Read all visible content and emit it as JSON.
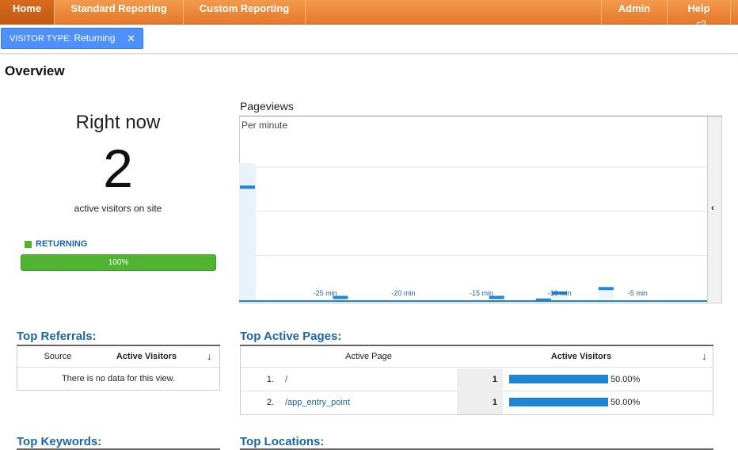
{
  "nav": {
    "home": "Home",
    "standard_reporting": "Standard Reporting",
    "custom_reporting": "Custom Reporting",
    "admin": "Admin",
    "help": "Help"
  },
  "filter": {
    "label": "VISITOR TYPE:",
    "value": "Returning",
    "close": "✕"
  },
  "page_title": "Overview",
  "right_now": {
    "title": "Right now",
    "count": "2",
    "subtitle": "active visitors on site",
    "legend": "RETURNING",
    "bar_label": "100%",
    "bar_fraction": 1.0,
    "legend_color": "#50b432"
  },
  "pageviews": {
    "title": "Pageviews",
    "subtitle": "Per minute",
    "collapse_icon": "‹"
  },
  "chart_data": {
    "type": "bar",
    "title": "Pageviews",
    "subtitle": "Per minute",
    "ylim": [
      0,
      30
    ],
    "y_ticks": [
      "30",
      "20",
      "10"
    ],
    "x_ticks": [
      "-25 min",
      "-20 min",
      "-15 min",
      "-10 min",
      "-5 min"
    ],
    "x_tick_values": [
      -25,
      -20,
      -15,
      -10,
      -5
    ],
    "xlim": [
      -30,
      0
    ],
    "series": [
      {
        "x": [
          -30,
          -24,
          -14,
          -11,
          -10,
          -7
        ],
        "values": [
          26,
          1,
          1,
          0.4,
          2,
          3
        ]
      }
    ],
    "grid": true,
    "bar_color": "#1f84d6"
  },
  "top_referrals": {
    "heading": "Top Referrals:",
    "col_source": "Source",
    "col_active": "Active Visitors",
    "empty": "There is no data for this view."
  },
  "top_pages": {
    "heading": "Top Active Pages:",
    "col_page": "Active Page",
    "col_active": "Active Visitors",
    "rows": [
      {
        "rank": "1.",
        "page": "/",
        "count": "1",
        "pct": "50.00%",
        "fraction": 0.5
      },
      {
        "rank": "2.",
        "page": "/app_entry_point",
        "count": "1",
        "pct": "50.00%",
        "fraction": 0.5
      }
    ]
  },
  "top_keywords": {
    "heading": "Top Keywords:"
  },
  "top_locations": {
    "heading": "Top Locations:"
  }
}
